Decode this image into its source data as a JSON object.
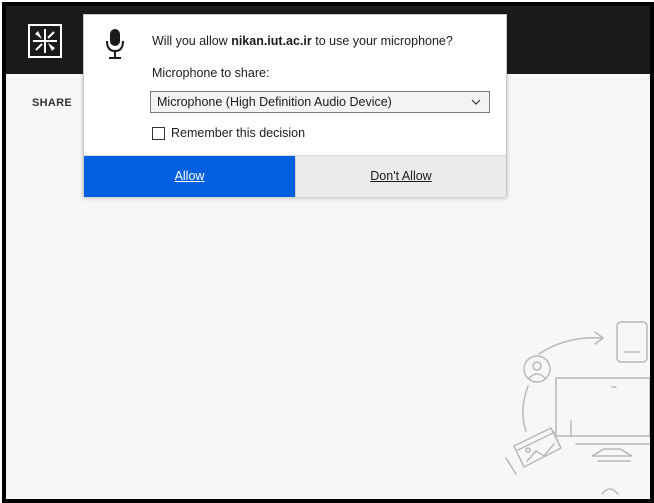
{
  "dialog": {
    "question_prefix": "Will you allow ",
    "site": "nikan.iut.ac.ir",
    "question_suffix": " to use your microphone?",
    "field_label": "Microphone to share:",
    "selected_device": "Microphone (High Definition Audio Device)",
    "remember_label": "Remember this decision",
    "remember_checked": false,
    "allow_label": "Allow",
    "deny_label": "Don't Allow"
  },
  "app": {
    "share_label": "SHARE"
  },
  "colors": {
    "allow_button": "#0060df",
    "top_bar": "#1a1a1a",
    "panel_background": "#f7f7f7"
  },
  "icons": {
    "dialog": "microphone-icon",
    "select": "chevron-down-icon",
    "app": "app-logo-icon"
  }
}
